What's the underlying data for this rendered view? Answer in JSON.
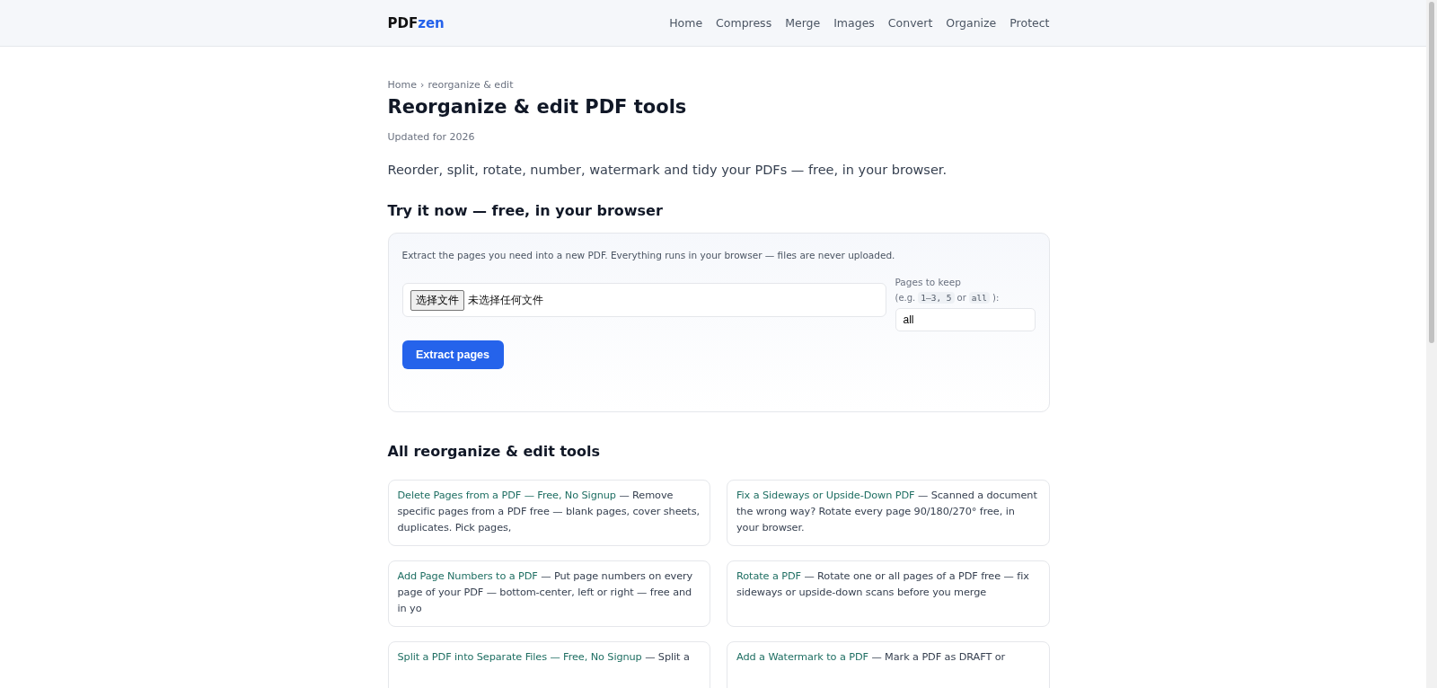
{
  "header": {
    "logo": {
      "main": "PDF",
      "accent": "zen"
    },
    "nav": [
      {
        "label": "Home"
      },
      {
        "label": "Compress"
      },
      {
        "label": "Merge"
      },
      {
        "label": "Images"
      },
      {
        "label": "Convert"
      },
      {
        "label": "Organize"
      },
      {
        "label": "Protect"
      }
    ]
  },
  "breadcrumb": {
    "home": "Home",
    "separator": "›",
    "current": "reorganize & edit"
  },
  "title": "Reorganize & edit PDF tools",
  "updated": "Updated for 2026",
  "lead": "Reorder, split, rotate, number, watermark and tidy your PDFs — free, in your browser.",
  "try_heading": "Try it now — free, in your browser",
  "tool": {
    "intro": "Extract the pages you need into a new PDF. Everything runs in your browser — files are never uploaded.",
    "file_button": "选择文件",
    "file_status": "未选择任何文件",
    "pages_label": "Pages to keep",
    "hint": [
      {
        "kind": "text",
        "text": "(e.g."
      },
      {
        "kind": "code",
        "text": "1–3, 5"
      },
      {
        "kind": "text",
        "text": "or"
      },
      {
        "kind": "code",
        "text": "all"
      },
      {
        "kind": "text",
        "text": "):"
      }
    ],
    "pages_value": "all",
    "submit": "Extract pages"
  },
  "tools_heading": "All reorganize & edit tools",
  "tools": [
    {
      "link": "Delete Pages from a PDF — Free, No Signup",
      "text": " — Remove specific pages from a PDF free — blank pages, cover sheets, duplicates. Pick pages,"
    },
    {
      "link": "Fix a Sideways or Upside-Down PDF",
      "text": " — Scanned a document the wrong way? Rotate every page 90/180/270° free, in your browser."
    },
    {
      "link": "Add Page Numbers to a PDF",
      "text": " — Put page numbers on every page of your PDF — bottom-center, left or right — free and in yo"
    },
    {
      "link": "Rotate a PDF",
      "text": " — Rotate one or all pages of a PDF free — fix sideways or upside-down scans before you merge"
    },
    {
      "link": "Split a PDF into Separate Files — Free, No Signup",
      "text": " — Split a"
    },
    {
      "link": "Add a Watermark to a PDF",
      "text": " — Mark a PDF as DRAFT or"
    }
  ]
}
